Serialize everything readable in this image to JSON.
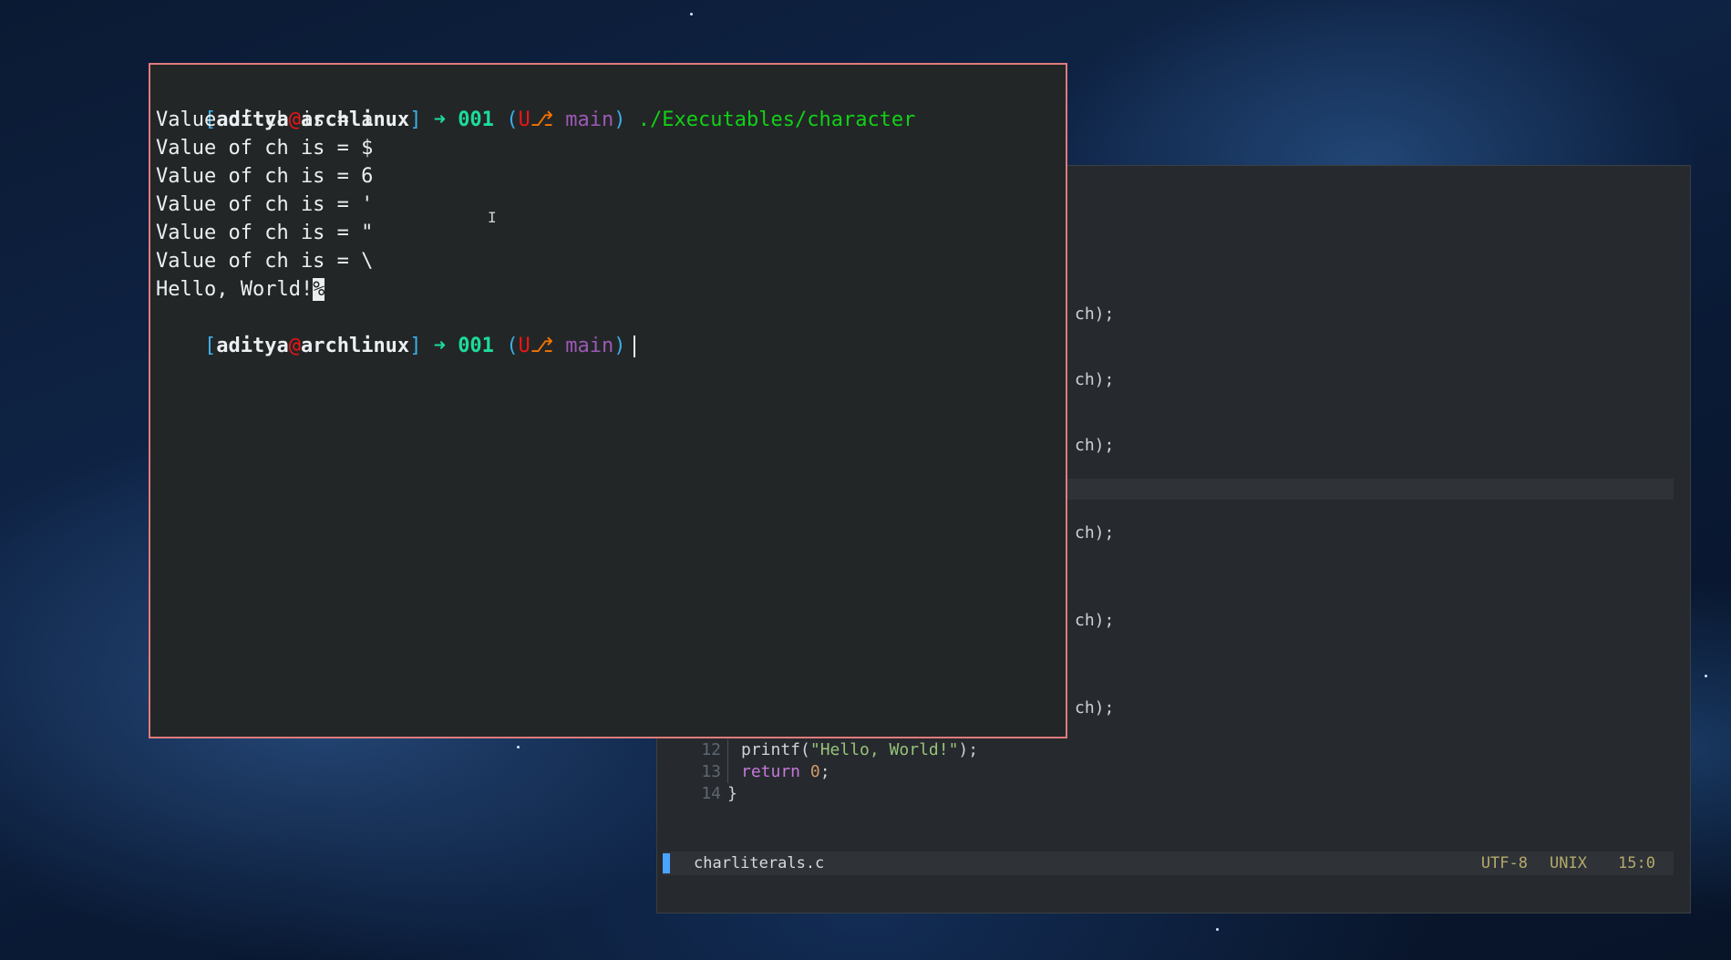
{
  "terminal": {
    "prompt": {
      "open_bracket": "[",
      "user": "aditya",
      "at": "@",
      "host": "archlinux",
      "close_bracket": "]",
      "arrow": "➜",
      "count": "001",
      "paren_open": "(",
      "git_u": "U",
      "branch_icon": "⎇",
      "branch": "main",
      "paren_close": ")"
    },
    "command": "./Executables/character",
    "output": [
      "Value of ch is = a",
      "Value of ch is = $",
      "Value of ch is = 6",
      "Value of ch is = '",
      "Value of ch is = \"",
      "Value of ch is = \\"
    ],
    "last_output": "Hello, World!",
    "no_newline_marker": "%"
  },
  "editor": {
    "visible_fragments": [
      "ch);",
      "ch);",
      "ch);",
      "ch);",
      "ch);",
      "ch);"
    ],
    "lines": [
      {
        "num": "12",
        "pre": "printf(",
        "str": "\"Hello, World!\"",
        "post": ");"
      },
      {
        "num": "13",
        "kw": "return",
        "num_val": "0",
        "post": ";"
      },
      {
        "num": "14",
        "text": "}"
      }
    ],
    "status": {
      "filename": "charliterals.c",
      "encoding": "UTF-8",
      "line_ending": "UNIX",
      "position": "15:0"
    }
  },
  "colors": {
    "terminal_border": "#e07b7b",
    "terminal_bg": "#232627",
    "editor_bg": "#262a2e",
    "prompt_bracket": "#3daee9",
    "prompt_at": "#ed1515",
    "prompt_arrow": "#1cdc9a",
    "prompt_branch": "#9b59b6",
    "command": "#11d116"
  }
}
